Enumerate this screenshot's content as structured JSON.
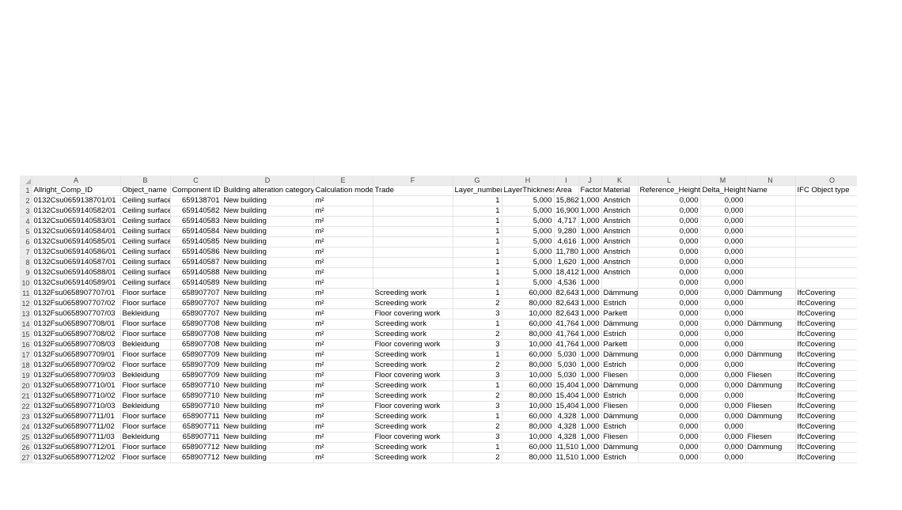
{
  "columns": [
    "A",
    "B",
    "C",
    "D",
    "E",
    "F",
    "G",
    "H",
    "I",
    "J",
    "K",
    "L",
    "M",
    "N",
    "O",
    ""
  ],
  "col_widths": [
    112,
    63,
    65,
    116,
    75,
    101,
    62,
    66,
    31,
    29,
    46,
    79,
    57,
    63,
    93,
    5
  ],
  "numeric_cols": [
    2,
    6,
    7,
    8,
    9,
    11,
    12
  ],
  "headers": [
    "Allright_Comp_ID",
    "Object_name",
    "Component ID",
    "Building alteration category",
    "Calculation mode",
    "Trade",
    "Layer_number",
    "LayerThickness",
    "Area",
    "Factor",
    "Material",
    "Reference_Height",
    "Delta_Height",
    "Name",
    "IFC Object type",
    ""
  ],
  "rows": [
    [
      "0132Csu0659138701/01",
      "Ceiling surface",
      "659138701",
      "New building",
      "m²",
      "",
      "1",
      "5,000",
      "15,862",
      "1,000",
      "Anstrich",
      "0,000",
      "0,000",
      "",
      "",
      ""
    ],
    [
      "0132Csu0659140582/01",
      "Ceiling surface",
      "659140582",
      "New building",
      "m²",
      "",
      "1",
      "5,000",
      "16,900",
      "1,000",
      "Anstrich",
      "0,000",
      "0,000",
      "",
      "",
      ""
    ],
    [
      "0132Csu0659140583/01",
      "Ceiling surface",
      "659140583",
      "New building",
      "m²",
      "",
      "1",
      "5,000",
      "4,717",
      "1,000",
      "Anstrich",
      "0,000",
      "0,000",
      "",
      "",
      ""
    ],
    [
      "0132Csu0659140584/01",
      "Ceiling surface",
      "659140584",
      "New building",
      "m²",
      "",
      "1",
      "5,000",
      "9,280",
      "1,000",
      "Anstrich",
      "0,000",
      "0,000",
      "",
      "",
      ""
    ],
    [
      "0132Csu0659140585/01",
      "Ceiling surface",
      "659140585",
      "New building",
      "m²",
      "",
      "1",
      "5,000",
      "4,616",
      "1,000",
      "Anstrich",
      "0,000",
      "0,000",
      "",
      "",
      ""
    ],
    [
      "0132Csu0659140586/01",
      "Ceiling surface",
      "659140586",
      "New building",
      "m²",
      "",
      "1",
      "5,000",
      "11,780",
      "1,000",
      "Anstrich",
      "0,000",
      "0,000",
      "",
      "",
      ""
    ],
    [
      "0132Csu0659140587/01",
      "Ceiling surface",
      "659140587",
      "New building",
      "m²",
      "",
      "1",
      "5,000",
      "1,620",
      "1,000",
      "Anstrich",
      "0,000",
      "0,000",
      "",
      "",
      ""
    ],
    [
      "0132Csu0659140588/01",
      "Ceiling surface",
      "659140588",
      "New building",
      "m²",
      "",
      "1",
      "5,000",
      "18,412",
      "1,000",
      "Anstrich",
      "0,000",
      "0,000",
      "",
      "",
      ""
    ],
    [
      "0132Csu0659140589/01",
      "Ceiling surface",
      "659140589",
      "New building",
      "m²",
      "",
      "1",
      "5,000",
      "4,536",
      "1,000",
      "",
      "0,000",
      "0,000",
      "",
      "",
      ""
    ],
    [
      "0132Fsu0658907707/01",
      "Floor surface",
      "658907707",
      "New building",
      "m²",
      "Screeding work",
      "1",
      "60,000",
      "82,643",
      "1,000",
      "Dämmung",
      "0,000",
      "0,000",
      "Dämmung",
      "IfcCovering",
      ""
    ],
    [
      "0132Fsu0658907707/02",
      "Floor surface",
      "658907707",
      "New building",
      "m²",
      "Screeding work",
      "2",
      "80,000",
      "82,643",
      "1,000",
      "Estrich",
      "0,000",
      "0,000",
      "",
      "IfcCovering",
      ""
    ],
    [
      "0132Fsu0658907707/03",
      "Bekleidung",
      "658907707",
      "New building",
      "m²",
      "Floor covering work",
      "3",
      "10,000",
      "82,643",
      "1,000",
      "Parkett",
      "0,000",
      "0,000",
      "",
      "IfcCovering",
      ""
    ],
    [
      "0132Fsu0658907708/01",
      "Floor surface",
      "658907708",
      "New building",
      "m²",
      "Screeding work",
      "1",
      "60,000",
      "41,764",
      "1,000",
      "Dämmung",
      "0,000",
      "0,000",
      "Dämmung",
      "IfcCovering",
      ""
    ],
    [
      "0132Fsu0658907708/02",
      "Floor surface",
      "658907708",
      "New building",
      "m²",
      "Screeding work",
      "2",
      "80,000",
      "41,764",
      "1,000",
      "Estrich",
      "0,000",
      "0,000",
      "",
      "IfcCovering",
      ""
    ],
    [
      "0132Fsu0658907708/03",
      "Bekleidung",
      "658907708",
      "New building",
      "m²",
      "Floor covering work",
      "3",
      "10,000",
      "41,764",
      "1,000",
      "Parkett",
      "0,000",
      "0,000",
      "",
      "IfcCovering",
      ""
    ],
    [
      "0132Fsu0658907709/01",
      "Floor surface",
      "658907709",
      "New building",
      "m²",
      "Screeding work",
      "1",
      "60,000",
      "5,030",
      "1,000",
      "Dämmung",
      "0,000",
      "0,000",
      "Dämmung",
      "IfcCovering",
      ""
    ],
    [
      "0132Fsu0658907709/02",
      "Floor surface",
      "658907709",
      "New building",
      "m²",
      "Screeding work",
      "2",
      "80,000",
      "5,030",
      "1,000",
      "Estrich",
      "0,000",
      "0,000",
      "",
      "IfcCovering",
      ""
    ],
    [
      "0132Fsu0658907709/03",
      "Bekleidung",
      "658907709",
      "New building",
      "m²",
      "Floor covering work",
      "3",
      "10,000",
      "5,030",
      "1,000",
      "Fliesen",
      "0,000",
      "0,000",
      "Fliesen",
      "IfcCovering",
      ""
    ],
    [
      "0132Fsu0658907710/01",
      "Floor surface",
      "658907710",
      "New building",
      "m²",
      "Screeding work",
      "1",
      "60,000",
      "15,404",
      "1,000",
      "Dämmung",
      "0,000",
      "0,000",
      "Dämmung",
      "IfcCovering",
      ""
    ],
    [
      "0132Fsu0658907710/02",
      "Floor surface",
      "658907710",
      "New building",
      "m²",
      "Screeding work",
      "2",
      "80,000",
      "15,404",
      "1,000",
      "Estrich",
      "0,000",
      "0,000",
      "",
      "IfcCovering",
      ""
    ],
    [
      "0132Fsu0658907710/03",
      "Bekleidung",
      "658907710",
      "New building",
      "m²",
      "Floor covering work",
      "3",
      "10,000",
      "15,404",
      "1,000",
      "Fliesen",
      "0,000",
      "0,000",
      "Fliesen",
      "IfcCovering",
      ""
    ],
    [
      "0132Fsu0658907711/01",
      "Floor surface",
      "658907711",
      "New building",
      "m²",
      "Screeding work",
      "1",
      "60,000",
      "4,328",
      "1,000",
      "Dämmung",
      "0,000",
      "0,000",
      "Dämmung",
      "IfcCovering",
      ""
    ],
    [
      "0132Fsu0658907711/02",
      "Floor surface",
      "658907711",
      "New building",
      "m²",
      "Screeding work",
      "2",
      "80,000",
      "4,328",
      "1,000",
      "Estrich",
      "0,000",
      "0,000",
      "",
      "IfcCovering",
      ""
    ],
    [
      "0132Fsu0658907711/03",
      "Bekleidung",
      "658907711",
      "New building",
      "m²",
      "Floor covering work",
      "3",
      "10,000",
      "4,328",
      "1,000",
      "Fliesen",
      "0,000",
      "0,000",
      "Fliesen",
      "IfcCovering",
      ""
    ],
    [
      "0132Fsu0658907712/01",
      "Floor surface",
      "658907712",
      "New building",
      "m²",
      "Screeding work",
      "1",
      "60,000",
      "11,510",
      "1,000",
      "Dämmung",
      "0,000",
      "0,000",
      "Dämmung",
      "IfcCovering",
      ""
    ],
    [
      "0132Fsu0658907712/02",
      "Floor surface",
      "658907712",
      "New building",
      "m²",
      "Screeding work",
      "2",
      "80,000",
      "11,510",
      "1,000",
      "Estrich",
      "0,000",
      "0,000",
      "",
      "IfcCovering",
      ""
    ]
  ]
}
